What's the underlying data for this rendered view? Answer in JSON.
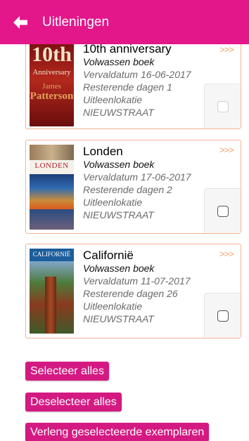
{
  "header": {
    "title": "Uitleningen"
  },
  "more_label": ">>>",
  "loans": [
    {
      "title": "10th anniversary",
      "type": "Volwassen boek",
      "due": "Vervaldatum 16-06-2017",
      "remaining": "Resterende dagen 1",
      "location_label": "Uitleenlokatie",
      "location": "NIEUWSTRAAT",
      "cover": {
        "line1": "10th",
        "line2": "Anniversary",
        "line3": "James",
        "line4": "Patterson"
      }
    },
    {
      "title": "Londen",
      "type": "Volwassen boek",
      "due": "Vervaldatum 17-06-2017",
      "remaining": "Resterende dagen 2",
      "location_label": "Uitleenlokatie",
      "location": "NIEUWSTRAAT",
      "cover": {
        "line1": "LONDEN"
      }
    },
    {
      "title": "Californië",
      "type": "Volwassen boek",
      "due": "Vervaldatum 11-07-2017",
      "remaining": "Resterende dagen 26",
      "location_label": "Uitleenlokatie",
      "location": "NIEUWSTRAAT",
      "cover": {
        "line1": "CALIFORNIË"
      }
    }
  ],
  "actions": {
    "select_all": "Selecteer alles",
    "deselect_all": "Deselecteer alles",
    "renew_selected": "Verleng geselecteerde exemplaren"
  }
}
